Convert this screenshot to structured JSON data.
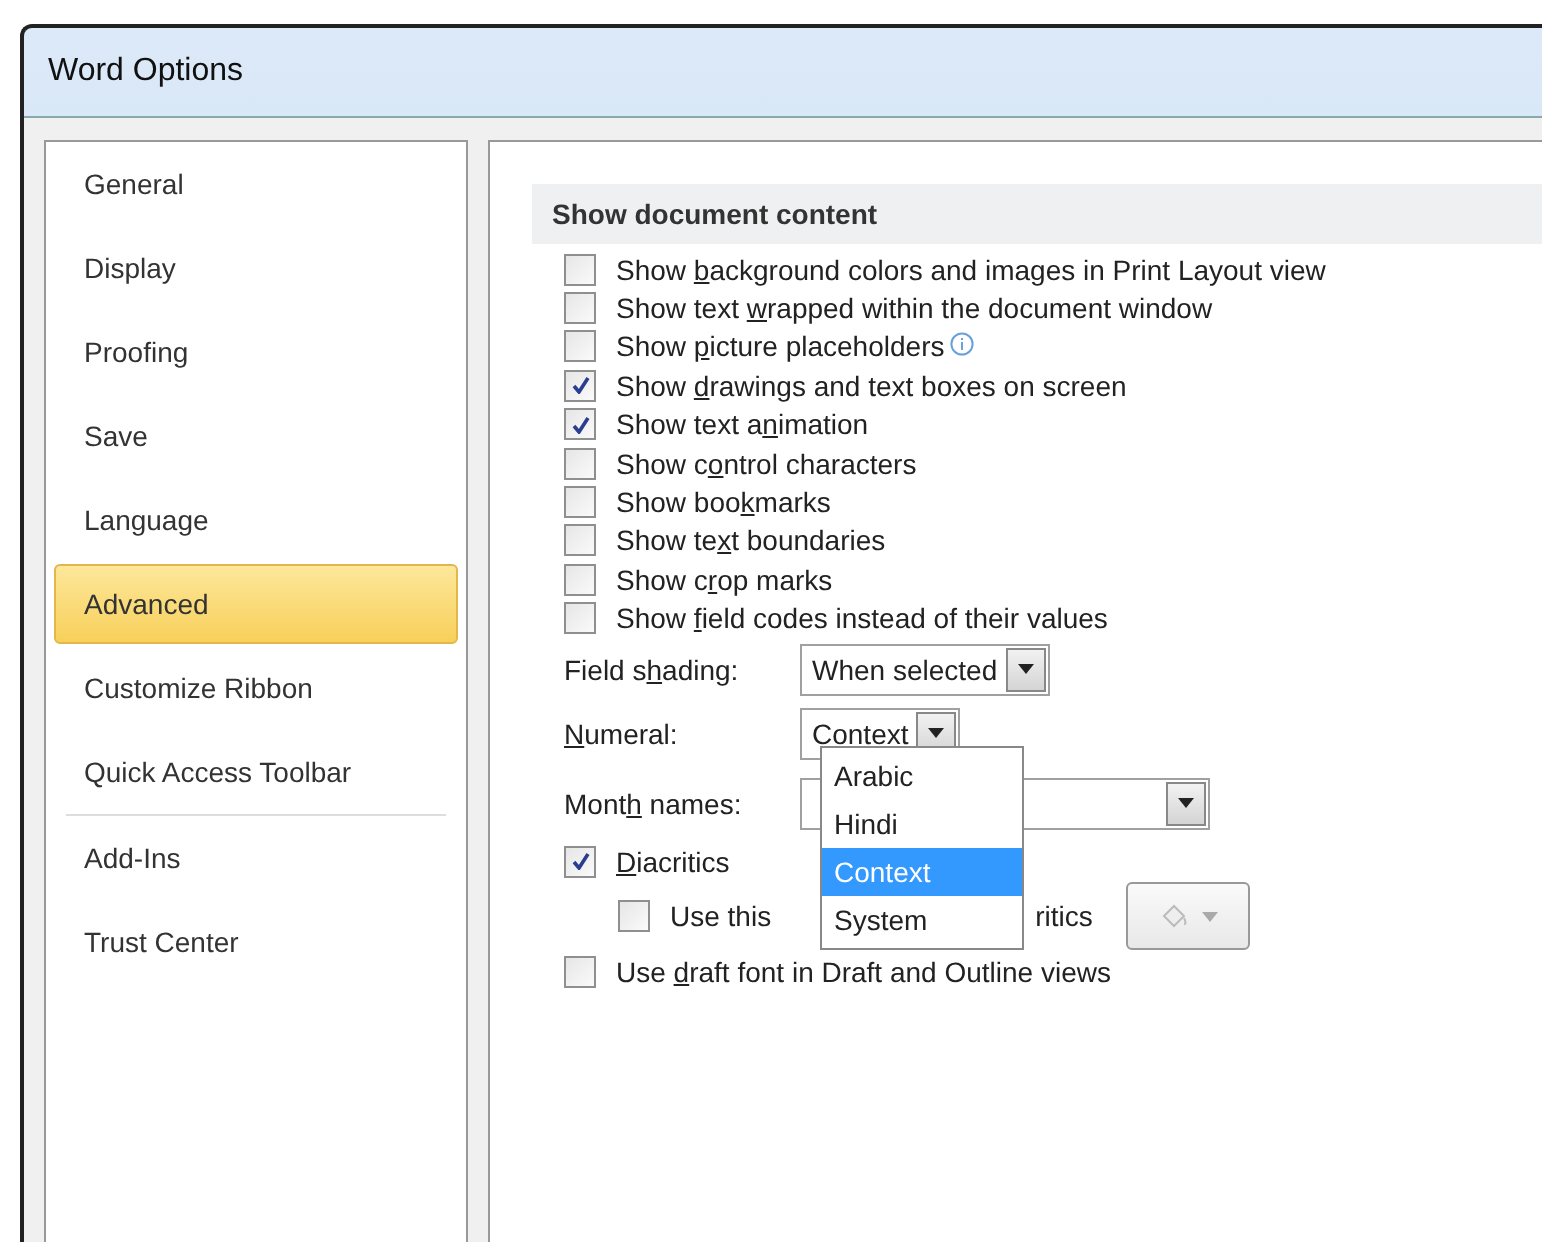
{
  "window": {
    "title": "Word Options"
  },
  "sidebar": {
    "groups": [
      [
        {
          "label": "General",
          "selected": false
        },
        {
          "label": "Display",
          "selected": false
        },
        {
          "label": "Proofing",
          "selected": false
        },
        {
          "label": "Save",
          "selected": false
        },
        {
          "label": "Language",
          "selected": false
        },
        {
          "label": "Advanced",
          "selected": true
        },
        {
          "label": "Customize Ribbon",
          "selected": false
        },
        {
          "label": "Quick Access Toolbar",
          "selected": false
        }
      ],
      [
        {
          "label": "Add-Ins",
          "selected": false
        },
        {
          "label": "Trust Center",
          "selected": false
        }
      ]
    ]
  },
  "section": {
    "title": "Show document content"
  },
  "options": [
    {
      "kind": "checkbox",
      "checked": false,
      "label": {
        "pre": "Show ",
        "key": "b",
        "post": "ackground colors and images in Print Layout view"
      }
    },
    {
      "kind": "checkbox",
      "checked": false,
      "label": {
        "pre": "Show text ",
        "key": "w",
        "post": "rapped within the document window"
      }
    },
    {
      "kind": "checkbox",
      "checked": false,
      "info": true,
      "label": {
        "pre": "Show ",
        "key": "p",
        "post": "icture placeholders"
      }
    },
    {
      "kind": "checkbox",
      "checked": true,
      "label": {
        "pre": "Show ",
        "key": "d",
        "post": "rawings and text boxes on screen"
      }
    },
    {
      "kind": "checkbox",
      "checked": true,
      "label": {
        "pre": "Show text a",
        "key": "n",
        "post": "imation"
      }
    },
    {
      "kind": "checkbox",
      "checked": false,
      "label": {
        "pre": "Show c",
        "key": "o",
        "post": "ntrol characters"
      }
    },
    {
      "kind": "checkbox",
      "checked": false,
      "label": {
        "pre": "Show boo",
        "key": "k",
        "post": "marks"
      }
    },
    {
      "kind": "checkbox",
      "checked": false,
      "label": {
        "pre": "Show te",
        "key": "x",
        "post": "t boundaries"
      }
    },
    {
      "kind": "checkbox",
      "checked": false,
      "label": {
        "pre": "Show c",
        "key": "r",
        "post": "op marks"
      }
    },
    {
      "kind": "checkbox",
      "checked": false,
      "label": {
        "pre": "Show ",
        "key": "f",
        "post": "ield codes instead of their values"
      }
    },
    {
      "kind": "dropdown",
      "value": "When selected",
      "label": {
        "pre": "Field s",
        "key": "h",
        "post": "ading:"
      }
    },
    {
      "kind": "dropdown",
      "value": "Context",
      "open": true,
      "menu": [
        {
          "label": "Arabic",
          "selected": false
        },
        {
          "label": "Hindi",
          "selected": false
        },
        {
          "label": "Context",
          "selected": true
        },
        {
          "label": "System",
          "selected": false
        }
      ],
      "label": {
        "key": "N",
        "post": "umeral:"
      }
    },
    {
      "kind": "wide_dropdown",
      "label": {
        "pre": "Mont",
        "key": "h",
        "post": " names:"
      }
    },
    {
      "kind": "checkbox",
      "checked": true,
      "label": {
        "key": "D",
        "post": "iacritics"
      }
    },
    {
      "kind": "colorrow",
      "checked": false,
      "label_start": "Use this",
      "label_end": "ritics"
    },
    {
      "kind": "checkbox",
      "checked": false,
      "label": {
        "pre": "Use ",
        "key": "d",
        "post": "raft font in Draft and Outline views"
      }
    }
  ]
}
